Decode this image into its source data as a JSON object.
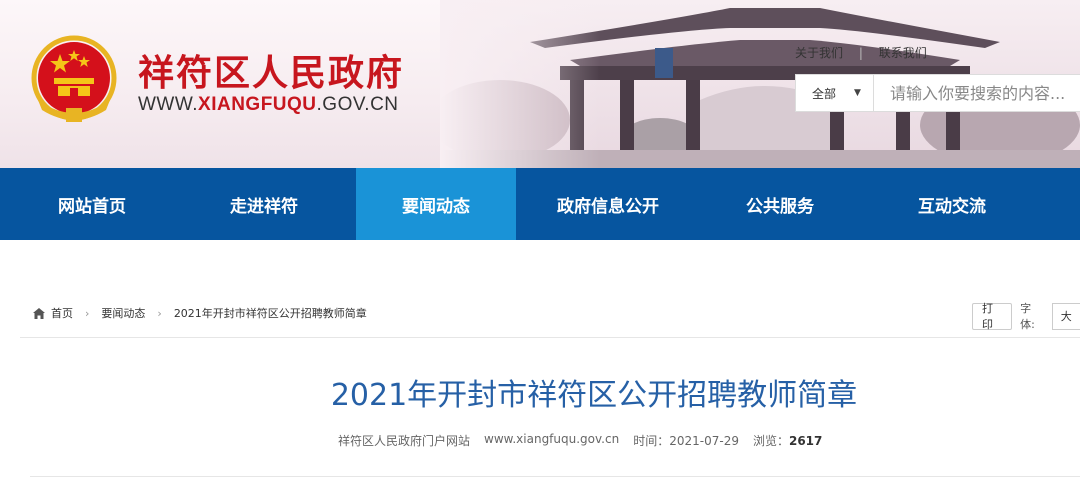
{
  "header": {
    "site_title": "祥符区人民政府",
    "site_url_prefix": "WWW.",
    "site_url_brand": "XIANGFUQU",
    "site_url_suffix": ".GOV.CN",
    "top_links": [
      "关于我们",
      "联系我们"
    ],
    "search": {
      "scope_label": "全部",
      "placeholder": "请输入你要搜索的内容..."
    }
  },
  "nav": {
    "items": [
      {
        "label": "网站首页"
      },
      {
        "label": "走进祥符"
      },
      {
        "label": "要闻动态",
        "active": true
      },
      {
        "label": "政府信息公开"
      },
      {
        "label": "公共服务"
      },
      {
        "label": "互动交流"
      }
    ]
  },
  "breadcrumb": {
    "home": "首页",
    "section": "要闻动态",
    "current": "2021年开封市祥符区公开招聘教师简章"
  },
  "tools": {
    "print_label": "打印",
    "font_label": "字体:",
    "font_size_value": "大"
  },
  "article": {
    "title": "2021年开封市祥符区公开招聘教师简章",
    "source": "祥符区人民政府门户网站",
    "source_url": "www.xiangfuqu.gov.cn",
    "time_label": "时间：",
    "time_value": "2021-07-29",
    "views_label": "浏览：",
    "views_value": "2617"
  },
  "colors": {
    "brand_red": "#c7161e",
    "nav_blue": "#06559f",
    "nav_active": "#1a93d7",
    "title_blue": "#2660a6"
  }
}
